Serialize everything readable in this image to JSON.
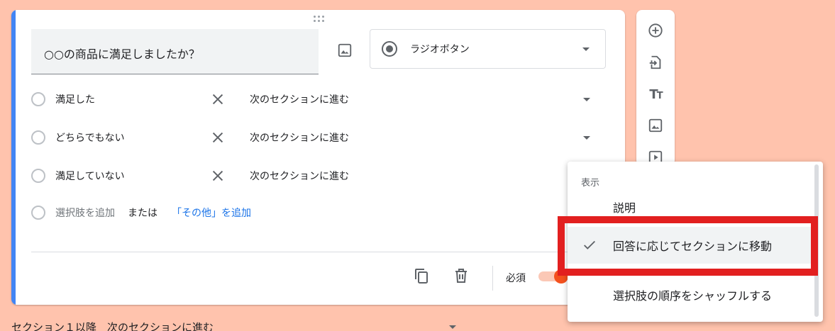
{
  "question": {
    "title": "○○の商品に満足しましたか？",
    "type_label": "ラジオボタン",
    "options": [
      {
        "label": "満足した",
        "goto": "次のセクションに進む"
      },
      {
        "label": "どちらでもない",
        "goto": "次のセクションに進む"
      },
      {
        "label": "満足していない",
        "goto": "次のセクションに進む"
      }
    ],
    "add_option": "選択肢を追加",
    "or_text": "または",
    "add_other": "「その他」を追加",
    "required_label": "必須",
    "required_on": true
  },
  "menu": {
    "header": "表示",
    "items": [
      {
        "label": "説明",
        "checked": false
      },
      {
        "label": "回答に応じてセクションに移動",
        "checked": true
      },
      {
        "label": "選択肢の順序をシャッフルする",
        "checked": false
      }
    ]
  },
  "footer": {
    "text": "セクション１以降　次のセクションに進む"
  },
  "colors": {
    "background": "#ffc3ad",
    "accent": "#4285f4",
    "link": "#1a73e8",
    "toggle_knob": "#f4511e",
    "highlight": "#e21f1f"
  },
  "icons": [
    "drag-handle-icon",
    "image-icon",
    "radio-icon",
    "close-icon",
    "copy-icon",
    "delete-icon",
    "add-circle-icon",
    "import-icon",
    "title-icon",
    "image-icon",
    "video-icon",
    "check-icon"
  ]
}
